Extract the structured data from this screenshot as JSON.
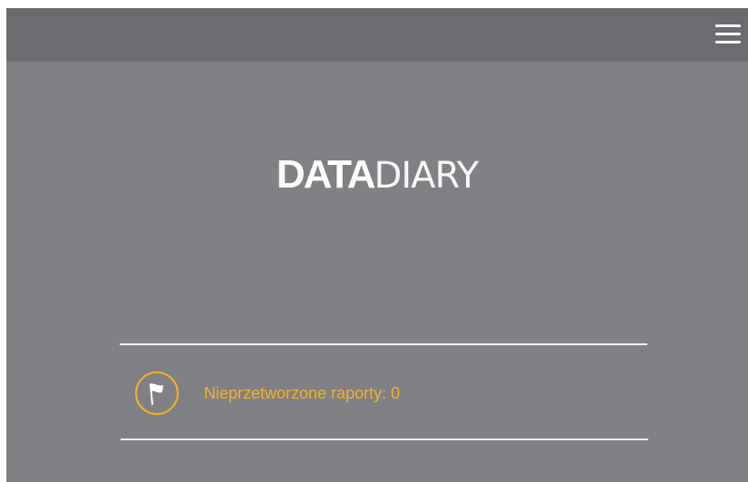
{
  "header": {
    "menu_icon": "hamburger-menu-icon"
  },
  "logo": {
    "bold": "DATA",
    "light": "DIARY"
  },
  "reports": {
    "icon": "flag-icon",
    "label": "Nieprzetworzone raporty: 0"
  },
  "colors": {
    "background": "#808184",
    "topbar": "#6b6c6f",
    "accent": "#f5b027",
    "text_light": "#ffffff"
  }
}
